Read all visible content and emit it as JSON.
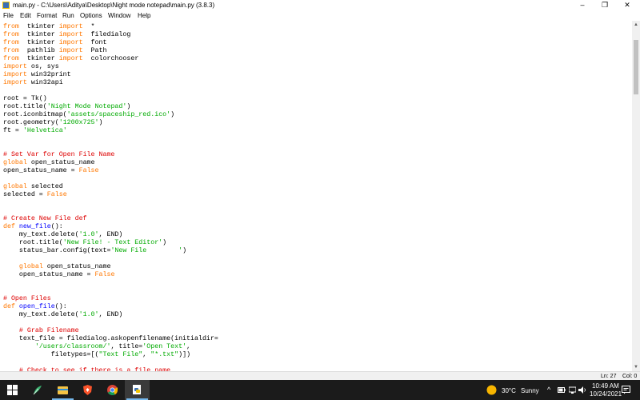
{
  "window": {
    "title": "main.py - C:\\Users\\Aditya\\Desktop\\Night mode notepad\\main.py (3.8.3)",
    "controls": {
      "minimize": "–",
      "restore": "❐",
      "close": "✕"
    }
  },
  "menu": [
    "File",
    "Edit",
    "Format",
    "Run",
    "Options",
    "Window",
    "Help"
  ],
  "editor": {
    "lines": [
      [
        [
          "kw",
          "from"
        ],
        [
          "",
          "  tkinter "
        ],
        [
          "kw",
          "import"
        ],
        [
          "",
          "  *"
        ]
      ],
      [
        [
          "kw",
          "from"
        ],
        [
          "",
          "  tkinter "
        ],
        [
          "kw",
          "import"
        ],
        [
          "",
          "  filedialog"
        ]
      ],
      [
        [
          "kw",
          "from"
        ],
        [
          "",
          "  tkinter "
        ],
        [
          "kw",
          "import"
        ],
        [
          "",
          "  font"
        ]
      ],
      [
        [
          "kw",
          "from"
        ],
        [
          "",
          "  pathlib "
        ],
        [
          "kw",
          "import"
        ],
        [
          "",
          "  Path"
        ]
      ],
      [
        [
          "kw",
          "from"
        ],
        [
          "",
          "  tkinter "
        ],
        [
          "kw",
          "import"
        ],
        [
          "",
          "  colorchooser"
        ]
      ],
      [
        [
          "kw",
          "import"
        ],
        [
          "",
          " os, sys"
        ]
      ],
      [
        [
          "kw",
          "import"
        ],
        [
          "",
          " win32print"
        ]
      ],
      [
        [
          "kw",
          "import"
        ],
        [
          "",
          " win32api"
        ]
      ],
      [],
      [
        [
          "",
          "root = Tk()"
        ]
      ],
      [
        [
          "",
          "root.title("
        ],
        [
          "st",
          "'Night Mode Notepad'"
        ],
        [
          "",
          ")"
        ]
      ],
      [
        [
          "",
          "root.iconbitmap("
        ],
        [
          "st",
          "'assets/spaceship_red.ico'"
        ],
        [
          "",
          ")"
        ]
      ],
      [
        [
          "",
          "root.geometry("
        ],
        [
          "st",
          "'1200x725'"
        ],
        [
          "",
          ")"
        ]
      ],
      [
        [
          "",
          "ft = "
        ],
        [
          "st",
          "'Helvetica'"
        ]
      ],
      [],
      [],
      [
        [
          "cm",
          "# Set Var for Open File Name"
        ]
      ],
      [
        [
          "kw",
          "global"
        ],
        [
          "",
          " open_status_name"
        ]
      ],
      [
        [
          "",
          "open_status_name = "
        ],
        [
          "kw",
          "False"
        ]
      ],
      [],
      [
        [
          "kw",
          "global"
        ],
        [
          "",
          " selected"
        ]
      ],
      [
        [
          "",
          "selected = "
        ],
        [
          "kw",
          "False"
        ]
      ],
      [],
      [],
      [
        [
          "cm",
          "# Create New File def"
        ]
      ],
      [
        [
          "kw",
          "def"
        ],
        [
          "",
          " "
        ],
        [
          "df",
          "new_file"
        ],
        [
          "",
          "():"
        ]
      ],
      [
        [
          "",
          "    my_text.delete("
        ],
        [
          "st",
          "'1.0'"
        ],
        [
          "",
          ", END)"
        ]
      ],
      [
        [
          "",
          "    root.title("
        ],
        [
          "st",
          "'New File! - Text Editor'"
        ],
        [
          "",
          ")"
        ]
      ],
      [
        [
          "",
          "    status_bar.config(text="
        ],
        [
          "st",
          "'New File        '"
        ],
        [
          "",
          ")"
        ]
      ],
      [],
      [
        [
          "",
          "    "
        ],
        [
          "kw",
          "global"
        ],
        [
          "",
          " open_status_name"
        ]
      ],
      [
        [
          "",
          "    open_status_name = "
        ],
        [
          "kw",
          "False"
        ]
      ],
      [],
      [],
      [
        [
          "cm",
          "# Open Files"
        ]
      ],
      [
        [
          "kw",
          "def"
        ],
        [
          "",
          " "
        ],
        [
          "df",
          "open_file"
        ],
        [
          "",
          "():"
        ]
      ],
      [
        [
          "",
          "    my_text.delete("
        ],
        [
          "st",
          "'1.0'"
        ],
        [
          "",
          ", END)"
        ]
      ],
      [],
      [
        [
          "",
          "    "
        ],
        [
          "cm",
          "# Grab Filename"
        ]
      ],
      [
        [
          "",
          "    text_file = filedialog.askopenfilename(initialdir="
        ]
      ],
      [
        [
          "",
          "        "
        ],
        [
          "st",
          "'/users/classroom/'"
        ],
        [
          "",
          ", title="
        ],
        [
          "st",
          "'Open Text'"
        ],
        [
          "",
          ","
        ]
      ],
      [
        [
          "",
          "            filetypes=[("
        ],
        [
          "st",
          "\"Text File\""
        ],
        [
          "",
          ", "
        ],
        [
          "st",
          "\"*.txt\""
        ],
        [
          "",
          ")])"
        ]
      ],
      [],
      [
        [
          "",
          "    "
        ],
        [
          "cm",
          "# Check to see if there is a file name"
        ]
      ]
    ]
  },
  "status_bar": {
    "line": "Ln: 27",
    "column": "Col: 0"
  },
  "taskbar": {
    "weather": {
      "temperature": "30°C",
      "condition": "Sunny"
    },
    "clock": {
      "time": "10:49 AM",
      "date": "10/24/2021"
    },
    "tray_caret": "^",
    "icons": [
      "windows-start-icon",
      "feather-app-icon",
      "file-explorer-icon",
      "brave-browser-icon",
      "chrome-icon",
      "idle-python-icon"
    ]
  },
  "colors": {
    "keyword": "#ff7700",
    "string": "#00aa00",
    "comment": "#dd0000",
    "definition": "#0000ff",
    "taskbar": "#1b1b1b"
  }
}
